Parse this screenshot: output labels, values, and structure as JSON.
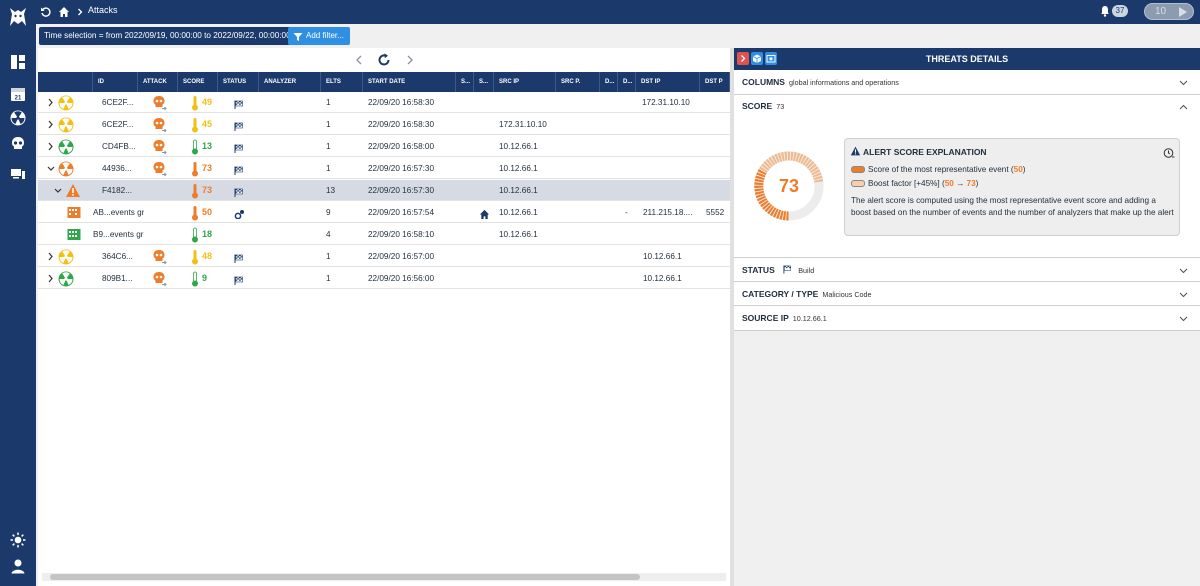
{
  "topbar": {
    "breadcrumb": "Attacks",
    "notification_count": "37",
    "refresh_value": "10"
  },
  "filterbar": {
    "time_selection": "Time selection = from 2022/09/19, 00:00:00 to 2022/09/22, 00:00:00",
    "add_filter": "Add filter..."
  },
  "table": {
    "columns": [
      "ID",
      "ATTACK",
      "SCORE",
      "STATUS",
      "ANALYZER",
      "ELTS",
      "START DATE",
      "S...",
      "S...",
      "SRC IP",
      "SRC P.",
      "D...",
      "D...",
      "DST IP",
      "DST P"
    ],
    "rows": [
      {
        "id": "6CE2F...",
        "score": "49",
        "elts": "1",
        "start": "22/09/20 16:58:30",
        "src_ip": "",
        "dst_ip": "172.31.10.10",
        "dst_p": ""
      },
      {
        "id": "6CE2F...",
        "score": "45",
        "elts": "1",
        "start": "22/09/20 16:58:30",
        "src_ip": "172.31.10.10",
        "dst_ip": "",
        "dst_p": ""
      },
      {
        "id": "CD4FB...",
        "score": "13",
        "elts": "1",
        "start": "22/09/20 16:58:00",
        "src_ip": "10.12.66.1",
        "dst_ip": "",
        "dst_p": ""
      },
      {
        "id": "44936...",
        "score": "73",
        "elts": "1",
        "start": "22/09/20 16:57:30",
        "src_ip": "10.12.66.1",
        "dst_ip": "",
        "dst_p": ""
      },
      {
        "id": "F4182...",
        "score": "73",
        "elts": "13",
        "start": "22/09/20 16:57:30",
        "src_ip": "10.12.66.1",
        "dst_ip": "",
        "dst_p": ""
      },
      {
        "id": "AB...events gr",
        "score": "50",
        "elts": "9",
        "start": "22/09/20 16:57:54",
        "src_ip": "10.12.66.1",
        "d_dash": "-",
        "dst_ip": "211.215.18....",
        "dst_p": "5552"
      },
      {
        "id": "B9...events gr",
        "score": "18",
        "elts": "4",
        "start": "22/09/20 16:58:10",
        "src_ip": "10.12.66.1",
        "dst_ip": "",
        "dst_p": ""
      },
      {
        "id": "364C6...",
        "score": "48",
        "elts": "1",
        "start": "22/09/20 16:57:00",
        "src_ip": "",
        "dst_ip": "10.12.66.1",
        "dst_p": ""
      },
      {
        "id": "809B1...",
        "score": "9",
        "elts": "1",
        "start": "22/09/20 16:56:00",
        "src_ip": "",
        "dst_ip": "10.12.66.1",
        "dst_p": ""
      }
    ]
  },
  "details": {
    "title": "THREATS DETAILS",
    "columns_label": "COLUMNS",
    "columns_sub": "global informations and operations",
    "score_label": "SCORE",
    "score_value": "73",
    "gauge_value": "73",
    "explain_title": "ALERT SCORE EXPLANATION",
    "explain_line1": "Score of the most representative event (",
    "explain_line1_val": "50",
    "explain_line1_end": ")",
    "explain_line2": "Boost factor [+45%] (",
    "explain_line2_from": "50",
    "explain_line2_arrow": "→",
    "explain_line2_to": "73",
    "explain_line2_end": ")",
    "explain_desc": "The alert score is computed using the most representative event score and adding a boost based on the number of events and the number of analyzers that make up the alert",
    "status_label": "STATUS",
    "status_value": "Build",
    "category_label": "CATEGORY / TYPE",
    "category_value": "Malicious Code",
    "source_label": "SOURCE IP",
    "source_value": "10.12.66.1"
  },
  "colors": {
    "navy": "#1b3a6b",
    "yellow": "#f2c014",
    "orange": "#ee7d2b",
    "green": "#2ea84a",
    "blue": "#2e8fe3"
  }
}
